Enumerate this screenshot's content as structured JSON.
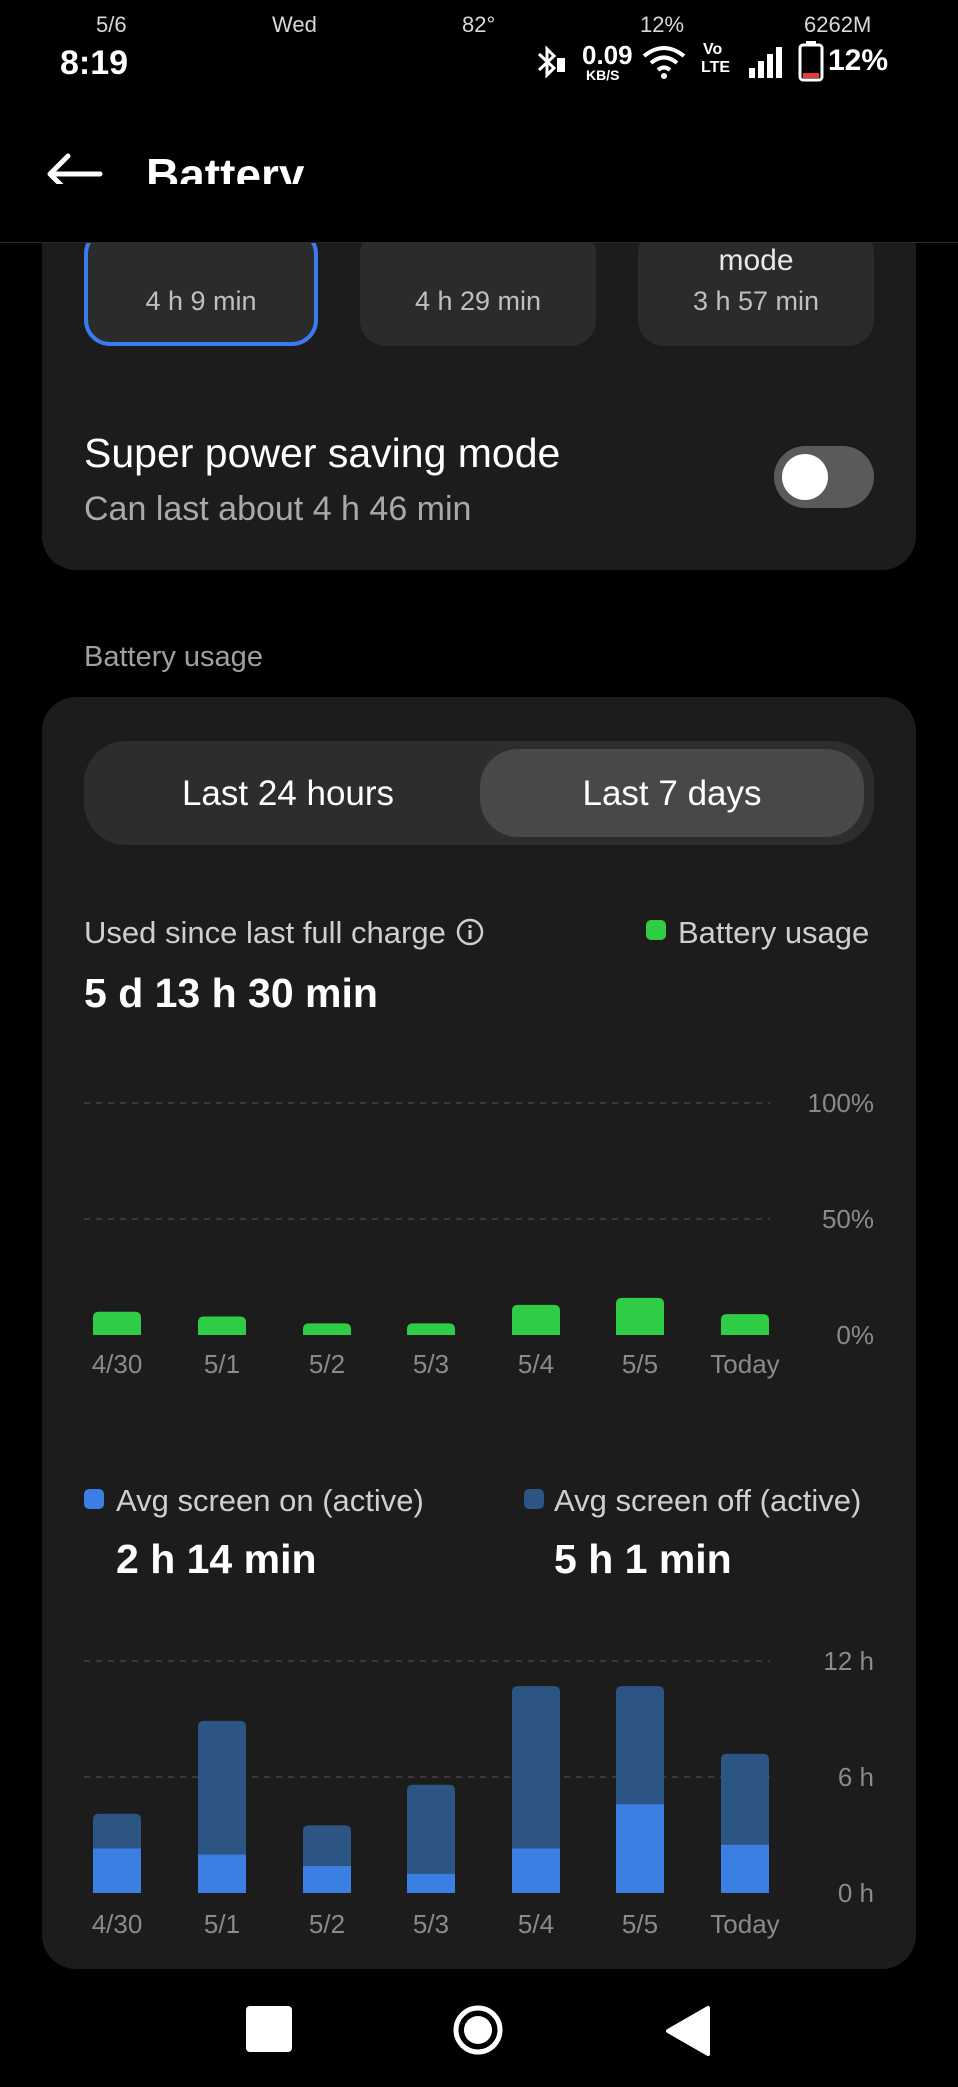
{
  "status_bar": {
    "date": "5/6",
    "day": "Wed",
    "temp": "82°",
    "time": "8:19",
    "net_speed_value": "0.09",
    "net_speed_unit": "KB/S",
    "top_battery_pct": "12%",
    "memory": "6262M",
    "volte_top": "Vo",
    "volte_bottom": "LTE",
    "battery_pct": "12%"
  },
  "header": {
    "title": "Battery"
  },
  "power_modes": [
    {
      "label": "",
      "time": "4 h 9 min",
      "selected": true
    },
    {
      "label": "",
      "time": "4 h 29 min",
      "selected": false
    },
    {
      "label": "mode",
      "time": "3 h 57 min",
      "selected": false
    }
  ],
  "super_saving": {
    "title": "Super power saving mode",
    "subtitle": "Can last about 4 h 46 min",
    "enabled": false
  },
  "usage_section": {
    "label": "Battery usage",
    "tabs": [
      "Last 24 hours",
      "Last 7 days"
    ],
    "active_tab": 1,
    "used_since_label": "Used since last full charge",
    "used_since_value": "5 d 13 h 30 min",
    "legend_label": "Battery usage"
  },
  "screen_stats": {
    "on_label": "Avg screen on (active)",
    "on_value": "2 h 14 min",
    "off_label": "Avg screen off (active)",
    "off_value": "5 h 1 min"
  },
  "colors": {
    "green": "#2fcc45",
    "screen_on": "#3b7fe3",
    "screen_off": "#2d5584",
    "selected_border": "#3a7bf0"
  },
  "chart_data": [
    {
      "type": "bar",
      "categories": [
        "4/30",
        "5/1",
        "5/2",
        "5/3",
        "5/4",
        "5/5",
        "Today"
      ],
      "series": [
        {
          "name": "Battery usage",
          "values": [
            10,
            8,
            5,
            5,
            13,
            16,
            9
          ]
        }
      ],
      "ylim": [
        0,
        100
      ],
      "yticks": [
        "100%",
        "50%",
        "0%"
      ],
      "grid": true
    },
    {
      "type": "bar",
      "stacked": true,
      "categories": [
        "4/30",
        "5/1",
        "5/2",
        "5/3",
        "5/4",
        "5/5",
        "Today"
      ],
      "series": [
        {
          "name": "Avg screen on (active)",
          "values": [
            2.3,
            2.0,
            1.4,
            1.0,
            2.3,
            4.6,
            2.5
          ]
        },
        {
          "name": "Avg screen off (active)",
          "values": [
            1.8,
            6.9,
            2.1,
            4.6,
            8.4,
            6.1,
            4.7
          ]
        }
      ],
      "ylim": [
        0,
        12
      ],
      "yticks": [
        "12 h",
        "6 h",
        "0 h"
      ],
      "grid": true
    }
  ],
  "nav": {
    "recent": "square-icon",
    "home": "circle-icon",
    "back": "triangle-back-icon"
  }
}
